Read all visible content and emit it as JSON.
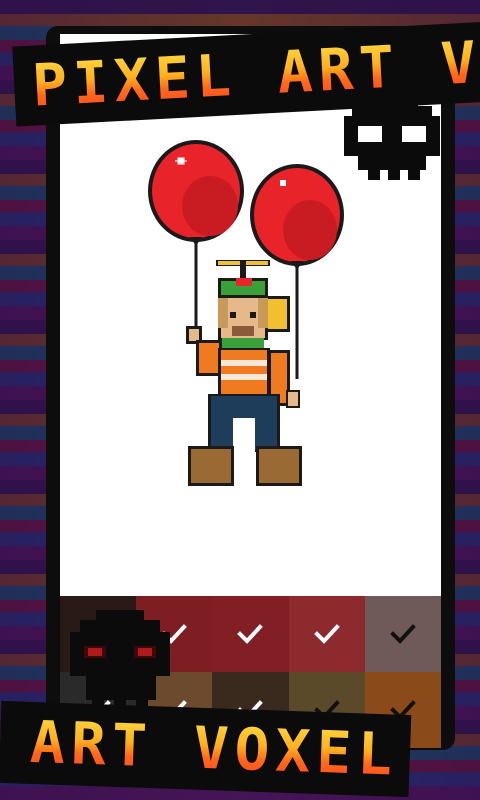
{
  "banners": {
    "top_text": "PIXEL ART VO",
    "bottom_text": "ART VOXEL"
  },
  "icons": {
    "top_skull": "skull-icon",
    "bottom_skull": "skull-icon",
    "check": "checkmark-icon"
  },
  "palette": [
    {
      "color": "#2a1a16",
      "checked": true
    },
    {
      "color": "#7e1e22",
      "checked": true
    },
    {
      "color": "#821f24",
      "checked": true
    },
    {
      "color": "#8d2a2e",
      "checked": true
    },
    {
      "color": "#6f5a59",
      "checked": true
    },
    {
      "color": "#2a2a2a",
      "checked": true
    },
    {
      "color": "#6b4a2e",
      "checked": true
    },
    {
      "color": "#3a2a1e",
      "checked": true
    },
    {
      "color": "#5a4a2a",
      "checked": true
    },
    {
      "color": "#8a4a1a",
      "checked": true
    }
  ],
  "colors": {
    "balloon": "#e8242a",
    "balloon_shadow": "#b01a1e",
    "outline": "#1a1a1a",
    "shirt_orange": "#f07a20",
    "shirt_white": "#f5e8d8",
    "jeans": "#1d3d5a",
    "boots": "#9a6a34",
    "hat_green": "#3aa03a",
    "skin": "#e7b88a",
    "backpack": "#f0c030"
  }
}
